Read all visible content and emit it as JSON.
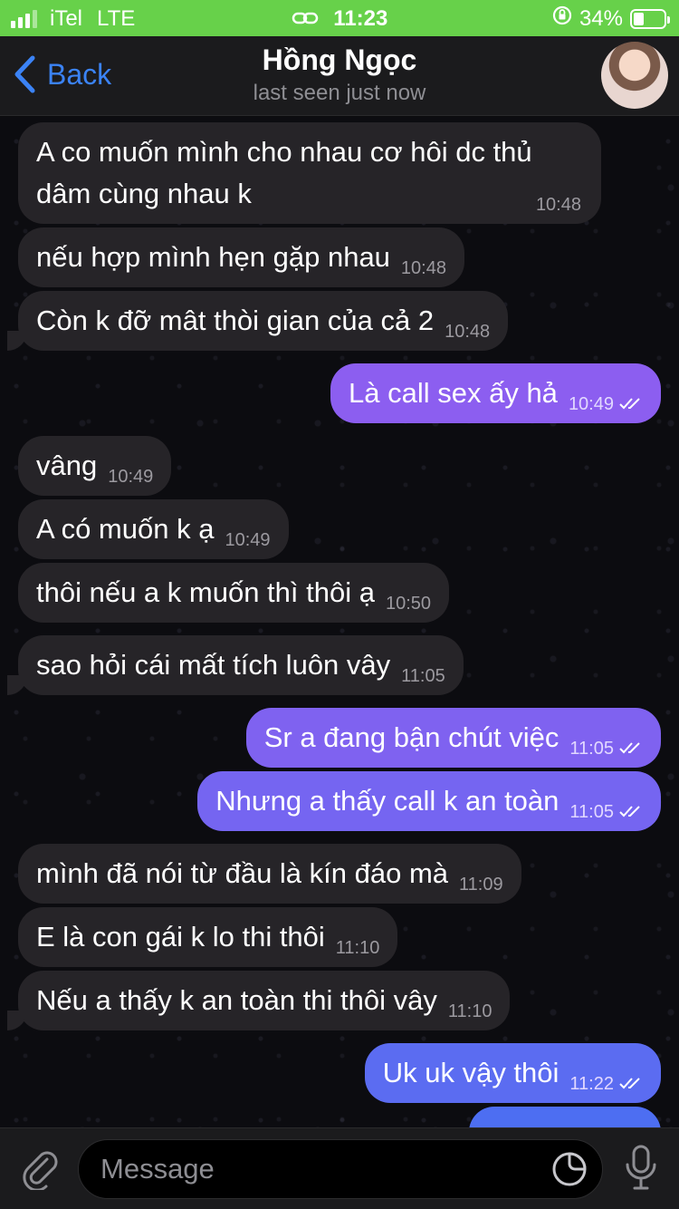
{
  "status_bar": {
    "carrier": "iTel",
    "network": "LTE",
    "time": "11:23",
    "battery_percent": "34%",
    "battery_level": 0.34,
    "accent_color": "#67d14a"
  },
  "header": {
    "back_label": "Back",
    "contact_name": "Hồng Ngọc",
    "status": "last seen just now",
    "accent_color": "#3b83f6"
  },
  "messages": [
    {
      "direction": "in",
      "text": "A co muốn mình cho nhau cơ hôi dc thủ dâm cùng nhau k",
      "time": "10:48"
    },
    {
      "direction": "in",
      "text": "nếu hợp mình hẹn gặp nhau",
      "time": "10:48"
    },
    {
      "direction": "in",
      "text": "Còn k đỡ mât thòi gian của cả 2",
      "time": "10:48"
    },
    {
      "direction": "out",
      "text": "Là call sex ấy hả",
      "time": "10:49",
      "read": true
    },
    {
      "direction": "in",
      "text": "vâng",
      "time": "10:49"
    },
    {
      "direction": "in",
      "text": "A có muốn k ạ",
      "time": "10:49"
    },
    {
      "direction": "in",
      "text": "thôi nếu a k muốn thì thôi ạ",
      "time": "10:50"
    },
    {
      "direction": "in",
      "text": "sao hỏi cái mất tích luôn vây",
      "time": "11:05"
    },
    {
      "direction": "out",
      "text": "Sr a đang bận chút việc",
      "time": "11:05",
      "read": true
    },
    {
      "direction": "out",
      "text": "Nhưng a thấy call k an toàn",
      "time": "11:05",
      "read": true
    },
    {
      "direction": "in",
      "text": "mình đã nói từ đầu là kín đáo mà",
      "time": "11:09"
    },
    {
      "direction": "in",
      "text": "E là con gái k lo thi thôi",
      "time": "11:10"
    },
    {
      "direction": "in",
      "text": "Nếu a thấy k an toàn thi thôi vây",
      "time": "11:10"
    },
    {
      "direction": "out",
      "text": "Uk uk vậy thôi",
      "time": "11:22",
      "read": true
    }
  ],
  "input_bar": {
    "placeholder": "Message"
  },
  "colors": {
    "incoming_bubble": "#262428",
    "outgoing_bubble_top": "#8c5cf0",
    "outgoing_bubble_bottom": "#4a6cf2",
    "background": "#0c0c10"
  },
  "icons": {
    "back": "chevron-left-icon",
    "attach": "paperclip-icon",
    "sticker": "sticker-icon",
    "mic": "microphone-icon",
    "read": "double-check-icon"
  }
}
